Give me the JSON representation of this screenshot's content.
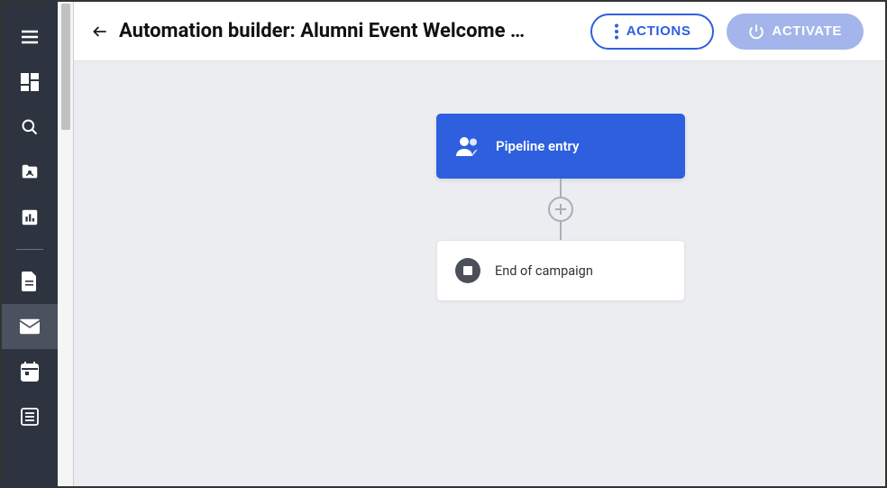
{
  "header": {
    "title": "Automation builder: Alumni Event Welcome …",
    "actions_label": "ACTIONS",
    "activate_label": "ACTIVATE"
  },
  "flow": {
    "entry_label": "Pipeline entry",
    "end_label": "End of campaign"
  }
}
